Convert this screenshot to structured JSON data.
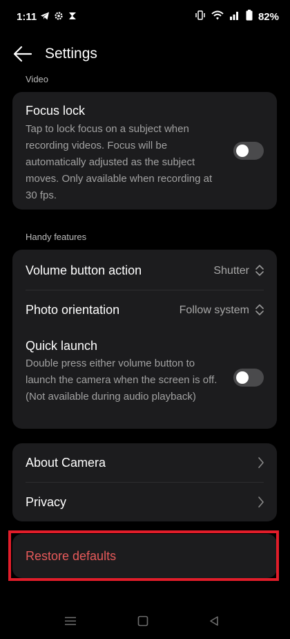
{
  "status": {
    "time": "1:11",
    "battery": "82%"
  },
  "header": {
    "title": "Settings"
  },
  "sections": {
    "video_label": "Video",
    "handy_label": "Handy features"
  },
  "focus_lock": {
    "title": "Focus lock",
    "description": "Tap to lock focus on a subject when recording videos. Focus will be automatically adjusted as the subject moves. Only available when recording at 30 fps.",
    "enabled": false
  },
  "volume_action": {
    "title": "Volume button action",
    "value": "Shutter"
  },
  "photo_orientation": {
    "title": "Photo orientation",
    "value": "Follow system"
  },
  "quick_launch": {
    "title": "Quick launch",
    "description": "Double press either volume button to launch the camera when the screen is off. (Not available during audio playback)",
    "enabled": false
  },
  "about": {
    "title": "About Camera"
  },
  "privacy": {
    "title": "Privacy"
  },
  "restore": {
    "label": "Restore defaults"
  },
  "colors": {
    "background": "#000000",
    "card": "#1c1c1e",
    "highlight_border": "#e11d2a",
    "restore_text": "#e75a5a"
  }
}
